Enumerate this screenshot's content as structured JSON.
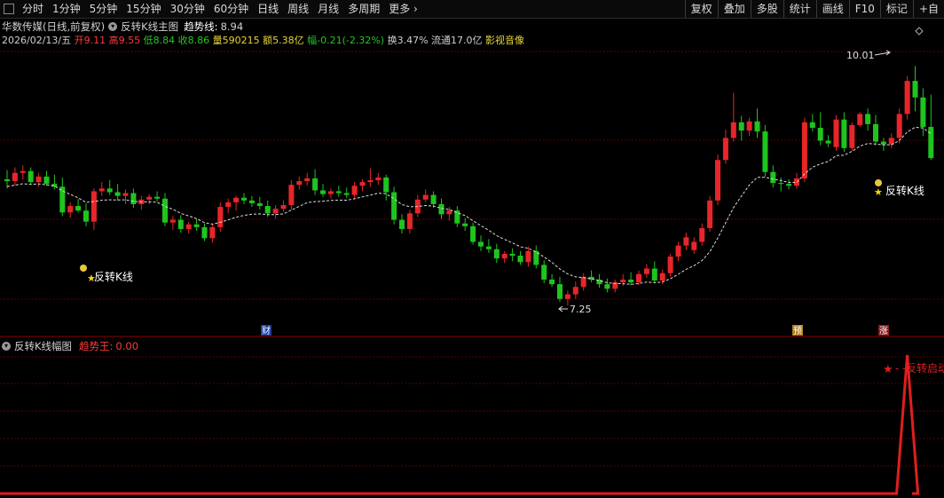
{
  "toolbar": {
    "periods": [
      "分时",
      "1分钟",
      "5分钟",
      "15分钟",
      "30分钟",
      "60分钟",
      "日线",
      "周线",
      "月线",
      "多周期",
      "更多"
    ],
    "right_buttons": [
      "复权",
      "叠加",
      "多股",
      "统计",
      "画线",
      "F10",
      "标记",
      "+自"
    ]
  },
  "header": {
    "stock_name": "华数传媒(日线,前复权)",
    "indicator_name": "反转K线主图",
    "trend_label": "趋势线:",
    "trend_value": "8.94"
  },
  "quote": {
    "date": "2026/02/13/五",
    "open_label": "开",
    "open": "9.11",
    "high_label": "高",
    "high": "9.55",
    "low_label": "低",
    "low": "8.84",
    "close_label": "收",
    "close": "8.86",
    "volume_label": "量",
    "volume": "590215",
    "amount_label": "额",
    "amount": "5.38亿",
    "change_label": "幅",
    "change": "-0.21(-2.32%)",
    "turnover_label": "换",
    "turnover": "3.47%",
    "float_label": "流通",
    "float": "17.0亿",
    "sector": "影视音像"
  },
  "chart_labels": {
    "high_mark": "10.01",
    "low_mark": "7.25",
    "signal_1": "反转K线",
    "signal_2": "反转K线",
    "tag_cai": "财",
    "tag_yu": "预",
    "tag_zhang": "涨",
    "sub_signal": "反转启动"
  },
  "sub_header": {
    "indicator_name": "反转K线幅图",
    "value_label": "趋势王:",
    "value": "0.00"
  },
  "colors": {
    "up": "#e8252a",
    "down": "#1fc41f",
    "trend": "#dcdcdc",
    "sub_line": "#e01e1e",
    "grid": "#5a0000"
  },
  "chart_data": {
    "type": "candlestick",
    "annotations": [
      "10.01",
      "7.25"
    ],
    "candles": [
      [
        8.63,
        8.73,
        8.53,
        8.61
      ],
      [
        8.61,
        8.76,
        8.56,
        8.7
      ],
      [
        8.7,
        8.78,
        8.63,
        8.72
      ],
      [
        8.72,
        8.76,
        8.57,
        8.6
      ],
      [
        8.6,
        8.7,
        8.55,
        8.66
      ],
      [
        8.66,
        8.72,
        8.56,
        8.58
      ],
      [
        8.58,
        8.68,
        8.52,
        8.55
      ],
      [
        8.55,
        8.65,
        8.23,
        8.27
      ],
      [
        8.27,
        8.38,
        8.21,
        8.34
      ],
      [
        8.34,
        8.42,
        8.27,
        8.29
      ],
      [
        8.29,
        8.37,
        8.12,
        8.17
      ],
      [
        8.17,
        8.53,
        8.08,
        8.5
      ],
      [
        8.5,
        8.6,
        8.45,
        8.53
      ],
      [
        8.53,
        8.62,
        8.46,
        8.49
      ],
      [
        8.49,
        8.58,
        8.4,
        8.45
      ],
      [
        8.45,
        8.52,
        8.36,
        8.48
      ],
      [
        8.48,
        8.53,
        8.32,
        8.36
      ],
      [
        8.36,
        8.45,
        8.3,
        8.41
      ],
      [
        8.41,
        8.47,
        8.36,
        8.44
      ],
      [
        8.44,
        8.5,
        8.39,
        8.42
      ],
      [
        8.42,
        8.48,
        8.12,
        8.16
      ],
      [
        8.16,
        8.23,
        8.08,
        8.19
      ],
      [
        8.19,
        8.24,
        8.05,
        8.09
      ],
      [
        8.09,
        8.17,
        8.04,
        8.14
      ],
      [
        8.14,
        8.2,
        8.07,
        8.11
      ],
      [
        8.11,
        8.15,
        7.96,
        7.99
      ],
      [
        7.99,
        8.15,
        7.94,
        8.11
      ],
      [
        8.11,
        8.38,
        8.06,
        8.33
      ],
      [
        8.33,
        8.42,
        8.26,
        8.38
      ],
      [
        8.38,
        8.45,
        8.29,
        8.43
      ],
      [
        8.43,
        8.48,
        8.36,
        8.4
      ],
      [
        8.4,
        8.45,
        8.33,
        8.37
      ],
      [
        8.37,
        8.44,
        8.3,
        8.34
      ],
      [
        8.34,
        8.4,
        8.22,
        8.26
      ],
      [
        8.26,
        8.35,
        8.2,
        8.31
      ],
      [
        8.31,
        8.4,
        8.28,
        8.35
      ],
      [
        8.35,
        8.62,
        8.3,
        8.57
      ],
      [
        8.57,
        8.66,
        8.52,
        8.61
      ],
      [
        8.61,
        8.7,
        8.56,
        8.64
      ],
      [
        8.64,
        8.74,
        8.46,
        8.51
      ],
      [
        8.51,
        8.58,
        8.44,
        8.47
      ],
      [
        8.47,
        8.53,
        8.42,
        8.5
      ],
      [
        8.5,
        8.56,
        8.44,
        8.48
      ],
      [
        8.48,
        8.54,
        8.43,
        8.46
      ],
      [
        8.46,
        8.6,
        8.42,
        8.56
      ],
      [
        8.56,
        8.63,
        8.5,
        8.6
      ],
      [
        8.6,
        8.75,
        8.55,
        8.62
      ],
      [
        8.62,
        8.7,
        8.57,
        8.65
      ],
      [
        8.65,
        8.68,
        8.4,
        8.49
      ],
      [
        8.49,
        8.55,
        8.14,
        8.19
      ],
      [
        8.19,
        8.25,
        8.04,
        8.09
      ],
      [
        8.09,
        8.3,
        8.04,
        8.26
      ],
      [
        8.26,
        8.46,
        8.22,
        8.41
      ],
      [
        8.41,
        8.52,
        8.38,
        8.46
      ],
      [
        8.46,
        8.5,
        8.32,
        8.36
      ],
      [
        8.36,
        8.42,
        8.2,
        8.25
      ],
      [
        8.25,
        8.33,
        8.18,
        8.29
      ],
      [
        8.29,
        8.34,
        8.11,
        8.15
      ],
      [
        8.15,
        8.21,
        8.07,
        8.12
      ],
      [
        8.12,
        8.16,
        7.92,
        7.95
      ],
      [
        7.95,
        8.02,
        7.85,
        7.9
      ],
      [
        7.9,
        7.98,
        7.83,
        7.87
      ],
      [
        7.87,
        7.93,
        7.72,
        7.77
      ],
      [
        7.77,
        7.85,
        7.72,
        7.82
      ],
      [
        7.82,
        7.88,
        7.74,
        7.8
      ],
      [
        7.8,
        7.85,
        7.7,
        7.73
      ],
      [
        7.73,
        7.9,
        7.68,
        7.85
      ],
      [
        7.85,
        7.91,
        7.66,
        7.7
      ],
      [
        7.7,
        7.75,
        7.5,
        7.54
      ],
      [
        7.54,
        7.6,
        7.46,
        7.49
      ],
      [
        7.49,
        7.57,
        7.3,
        7.33
      ],
      [
        7.33,
        7.42,
        7.26,
        7.38
      ],
      [
        7.38,
        7.52,
        7.33,
        7.46
      ],
      [
        7.46,
        7.61,
        7.42,
        7.57
      ],
      [
        7.57,
        7.64,
        7.51,
        7.54
      ],
      [
        7.54,
        7.6,
        7.45,
        7.49
      ],
      [
        7.49,
        7.55,
        7.4,
        7.44
      ],
      [
        7.44,
        7.54,
        7.4,
        7.51
      ],
      [
        7.51,
        7.6,
        7.47,
        7.54
      ],
      [
        7.54,
        7.62,
        7.48,
        7.51
      ],
      [
        7.51,
        7.64,
        7.48,
        7.6
      ],
      [
        7.6,
        7.71,
        7.56,
        7.66
      ],
      [
        7.66,
        7.74,
        7.5,
        7.53
      ],
      [
        7.53,
        7.65,
        7.49,
        7.61
      ],
      [
        7.61,
        7.82,
        7.57,
        7.79
      ],
      [
        7.79,
        7.95,
        7.74,
        7.91
      ],
      [
        7.91,
        8.05,
        7.86,
        8.0
      ],
      [
        7.86,
        8.0,
        7.82,
        7.95
      ],
      [
        7.95,
        8.15,
        7.91,
        8.1
      ],
      [
        8.1,
        8.45,
        8.06,
        8.4
      ],
      [
        8.4,
        8.9,
        8.35,
        8.84
      ],
      [
        8.84,
        9.17,
        8.8,
        9.08
      ],
      [
        9.08,
        9.57,
        9.04,
        9.25
      ],
      [
        9.25,
        9.32,
        9.05,
        9.16
      ],
      [
        9.16,
        9.3,
        9.1,
        9.26
      ],
      [
        9.26,
        9.4,
        9.08,
        9.15
      ],
      [
        9.15,
        9.22,
        8.66,
        8.71
      ],
      [
        8.71,
        8.78,
        8.54,
        8.59
      ],
      [
        8.59,
        8.65,
        8.5,
        8.58
      ],
      [
        8.58,
        8.63,
        8.52,
        8.56
      ],
      [
        8.56,
        8.7,
        8.53,
        8.64
      ],
      [
        8.64,
        9.3,
        8.6,
        9.25
      ],
      [
        9.25,
        9.34,
        9.15,
        9.19
      ],
      [
        9.19,
        9.36,
        9.0,
        9.05
      ],
      [
        9.05,
        9.11,
        8.98,
        9.02
      ],
      [
        8.98,
        9.33,
        8.94,
        9.28
      ],
      [
        9.28,
        9.36,
        8.93,
        8.97
      ],
      [
        8.97,
        9.25,
        8.94,
        9.22
      ],
      [
        9.22,
        9.36,
        9.2,
        9.34
      ],
      [
        9.34,
        9.4,
        9.16,
        9.23
      ],
      [
        9.23,
        9.33,
        9.0,
        9.04
      ],
      [
        9.04,
        9.08,
        8.94,
        9.01
      ],
      [
        9.01,
        9.13,
        8.97,
        9.08
      ],
      [
        9.08,
        9.4,
        9.02,
        9.34
      ],
      [
        9.34,
        9.75,
        9.28,
        9.7
      ],
      [
        9.7,
        9.86,
        9.37,
        9.52
      ],
      [
        9.52,
        9.62,
        9.1,
        9.2
      ],
      [
        9.2,
        9.55,
        8.84,
        8.86
      ]
    ],
    "sub_indicator": {
      "name": "趋势王",
      "spike_index": 114,
      "value": 0.0
    }
  }
}
